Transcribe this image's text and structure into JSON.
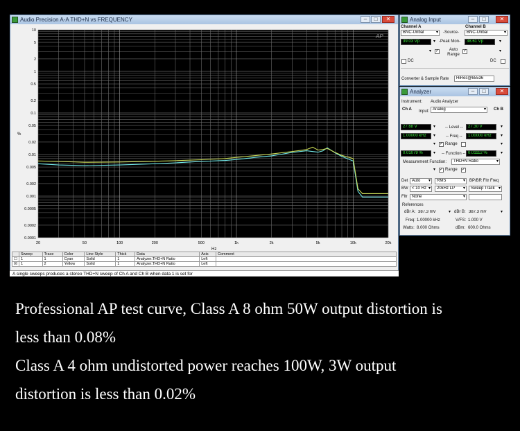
{
  "graph_window": {
    "title": "Audio Precision   A-A THD+N vs FREQUENCY",
    "logo": "AP",
    "y_unit": "%",
    "x_unit": "Hz",
    "y_ticks": [
      "10",
      "5",
      "2",
      "1",
      "0.5",
      "0.2",
      "0.1",
      "0.05",
      "0.02",
      "0.01",
      "0.005",
      "0.002",
      "0.001",
      "0.0005",
      "0.0002",
      "0.0001"
    ],
    "x_ticks": [
      "20",
      "50",
      "100",
      "200",
      "500",
      "1k",
      "2k",
      "5k",
      "10k",
      "20k"
    ]
  },
  "chart_data": {
    "type": "line",
    "x_scale": "log",
    "y_scale": "log",
    "xlim": [
      20,
      20000
    ],
    "ylim": [
      0.0001,
      10
    ],
    "xlabel": "Hz",
    "ylabel": "%",
    "grid": true,
    "series": [
      {
        "color": "#6fe8e8",
        "x": [
          20,
          30,
          50,
          100,
          200,
          300,
          500,
          800,
          1000,
          1500,
          2000,
          3000,
          4000,
          4500,
          5000,
          5500,
          6000,
          7000,
          8000,
          10000,
          11000,
          12000,
          20000
        ],
        "y": [
          0.006,
          0.0056,
          0.0054,
          0.0056,
          0.006,
          0.0063,
          0.0068,
          0.0072,
          0.0076,
          0.0086,
          0.0093,
          0.0112,
          0.0123,
          0.0118,
          0.0114,
          0.0122,
          0.0145,
          0.011,
          0.009,
          0.007,
          0.0013,
          0.00095,
          0.00095
        ]
      },
      {
        "color": "#c9d957",
        "x": [
          20,
          30,
          50,
          100,
          200,
          300,
          500,
          800,
          1000,
          1500,
          2000,
          3000,
          4000,
          4500,
          5000,
          5500,
          6000,
          7000,
          8000,
          10000,
          11000,
          12000,
          20000
        ],
        "y": [
          0.007,
          0.0068,
          0.0065,
          0.0066,
          0.0069,
          0.0071,
          0.0075,
          0.008,
          0.0085,
          0.0095,
          0.0103,
          0.0118,
          0.0132,
          0.015,
          0.0128,
          0.0132,
          0.014,
          0.0112,
          0.0095,
          0.008,
          0.0015,
          0.00115,
          0.00115
        ]
      }
    ]
  },
  "sweep_table": {
    "headers": [
      "Sweep",
      "Trace",
      "Color",
      "Line Style",
      "Thick",
      "Data",
      "Axis",
      "Comment"
    ],
    "rows": [
      {
        "sweep": "1",
        "trace": "1",
        "color": "Cyan",
        "style": "Solid",
        "thick": "1",
        "data": "Analyzer.THD+N Ratio",
        "axis": "Left",
        "comment": ""
      },
      {
        "sweep": "1",
        "trace": "2",
        "color": "Yellow",
        "style": "Solid",
        "thick": "1",
        "data": "Analyzer.THD+N Ratio",
        "axis": "Left",
        "comment": ""
      }
    ],
    "status": "A single sweeps produces a stereo THD+N sweep of Ch A and Ch B when data 1 is set for"
  },
  "analog_input": {
    "title": "Analog Input",
    "channel_a": "Channel A",
    "channel_b": "Channel B",
    "source_a": "BNC-Unbal",
    "source_label": "-Source-",
    "source_b": "BNC-Unbal",
    "peak_a": "39.03  Vp",
    "peak_label": "-Peak Mon-",
    "peak_b": "38.61  Vp",
    "auto_range": "Auto Range",
    "dc_a": "DC",
    "dc_b": "DC",
    "converter_label": "Converter & Sample Rate",
    "converter_value": "HiRes@65536"
  },
  "analyzer": {
    "title": "Analyzer",
    "instrument_label": "Instrument:",
    "instrument_value": "Audio Analyzer",
    "cha_label": "Ch A",
    "input_label": "Input:",
    "input_value": "Analog",
    "chb_label": "Ch B",
    "level_a": "27.68  V",
    "level_label": "-- Level --",
    "level_b": "27.30  V",
    "freq_a": "1.00000 kHz",
    "freq_label": "-- Freq --",
    "freq_b": "1.00000 kHz",
    "range_label": "Range",
    "function_a": "0.01079  %",
    "function_label": "-- Function --",
    "function_b": "0.01112  %",
    "meas_func_label": "Measurement Function:",
    "meas_func_value": "THD+N Ratio",
    "det_label": "Det",
    "det_value": "Auto",
    "det_mode": "RMS",
    "bp_label": "BP/BR Fltr Freq",
    "bw_label": "BW",
    "bw_low": "< 10 Hz",
    "bw_high": "20kHz LP",
    "sweep_track": "Sweep Track",
    "fltr_label": "Fltr",
    "fltr_value": "None",
    "references_label": "References",
    "dbra_label": "dBr A:",
    "dbra_value": "387.3  mV",
    "dbrb_label": "dBr B:",
    "dbrb_value": "387.3  mV",
    "freq_ref_label": "Freq:",
    "freq_ref_value": "1.00000 kHz",
    "vfs_label": "V/FS:",
    "vfs_value": "1.000   V",
    "watts_label": "Watts:",
    "watts_value": "8.000    Ohms",
    "dbm_label": "dBm:",
    "dbm_value": "600.0    Ohms"
  },
  "caption": {
    "line1": "Professional AP test curve, Class A 8 ohm 50W output distortion is",
    "line2": "less than 0.08%",
    "line3": "Class A 4 ohm undistorted power reaches 100W, 3W output",
    "line4": "distortion is less than 0.02%"
  }
}
